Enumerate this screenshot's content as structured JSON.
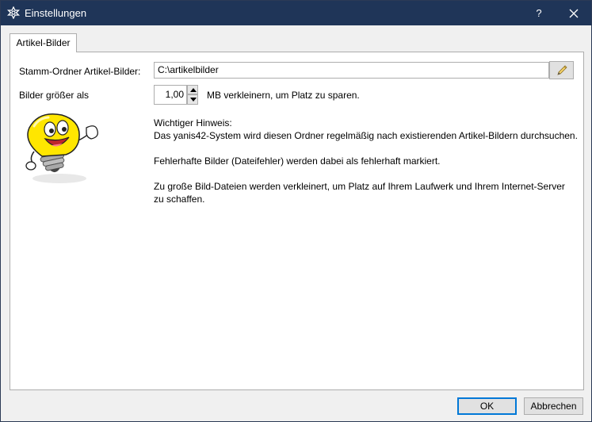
{
  "window": {
    "title": "Einstellungen",
    "help_label": "?",
    "icon": "gear-icon"
  },
  "tabs": [
    {
      "label": "Artikel-Bilder",
      "active": true
    }
  ],
  "form": {
    "folder_label": "Stamm-Ordner Artikel-Bilder:",
    "folder_value": "C:\\artikelbilder",
    "size_label": "Bilder größer als",
    "size_value": "1,00",
    "size_suffix": "MB verkleinern, um Platz zu sparen."
  },
  "info": {
    "heading": "Wichtiger Hinweis:",
    "line1": "Das yanis42-System wird diesen Ordner regelmäßig nach existierenden Artikel-Bildern durchsuchen.",
    "line2": "Fehlerhafte Bilder (Dateifehler) werden dabei als fehlerhaft markiert.",
    "line3a": "Zu große Bild-Dateien werden verkleinert, um Platz auf Ihrem Laufwerk und Ihrem Internet-Server",
    "line3b": "zu schaffen."
  },
  "buttons": {
    "ok": "OK",
    "cancel": "Abbrechen"
  },
  "colors": {
    "titlebar": "#1f3558",
    "accent": "#0078d7"
  }
}
